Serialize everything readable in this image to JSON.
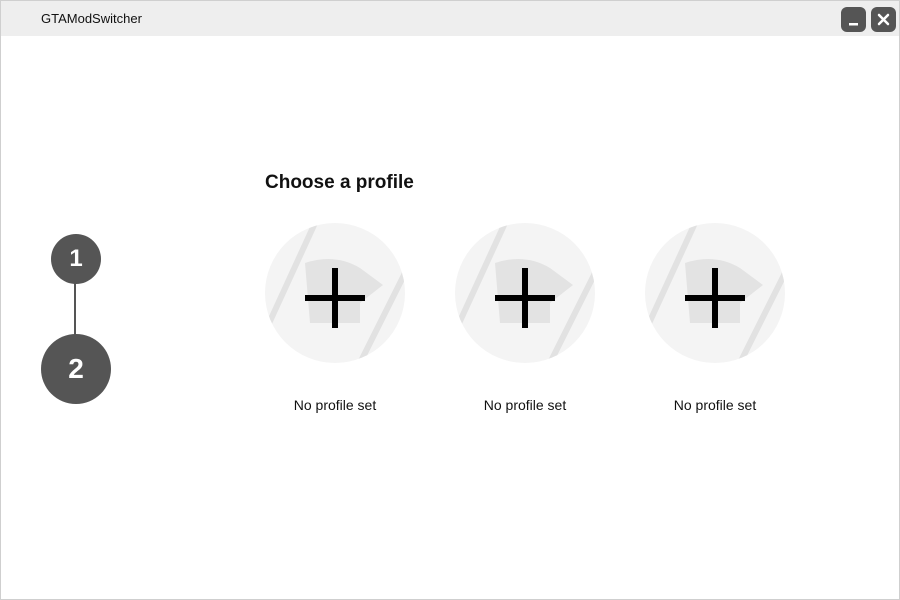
{
  "window": {
    "title": "GTAModSwitcher",
    "controls": {
      "minimize_icon": "minimize-icon",
      "close_icon": "close-icon"
    }
  },
  "stepper": {
    "steps": [
      {
        "label": "1",
        "active": false
      },
      {
        "label": "2",
        "active": true
      }
    ]
  },
  "main": {
    "heading": "Choose a profile",
    "profiles": [
      {
        "label": "No profile set",
        "icon": "add-profile-icon"
      },
      {
        "label": "No profile set",
        "icon": "add-profile-icon"
      },
      {
        "label": "No profile set",
        "icon": "add-profile-icon"
      }
    ]
  },
  "colors": {
    "accent": "#555555",
    "titlebar": "#eeeeee",
    "placeholder": "#f4f4f4"
  }
}
